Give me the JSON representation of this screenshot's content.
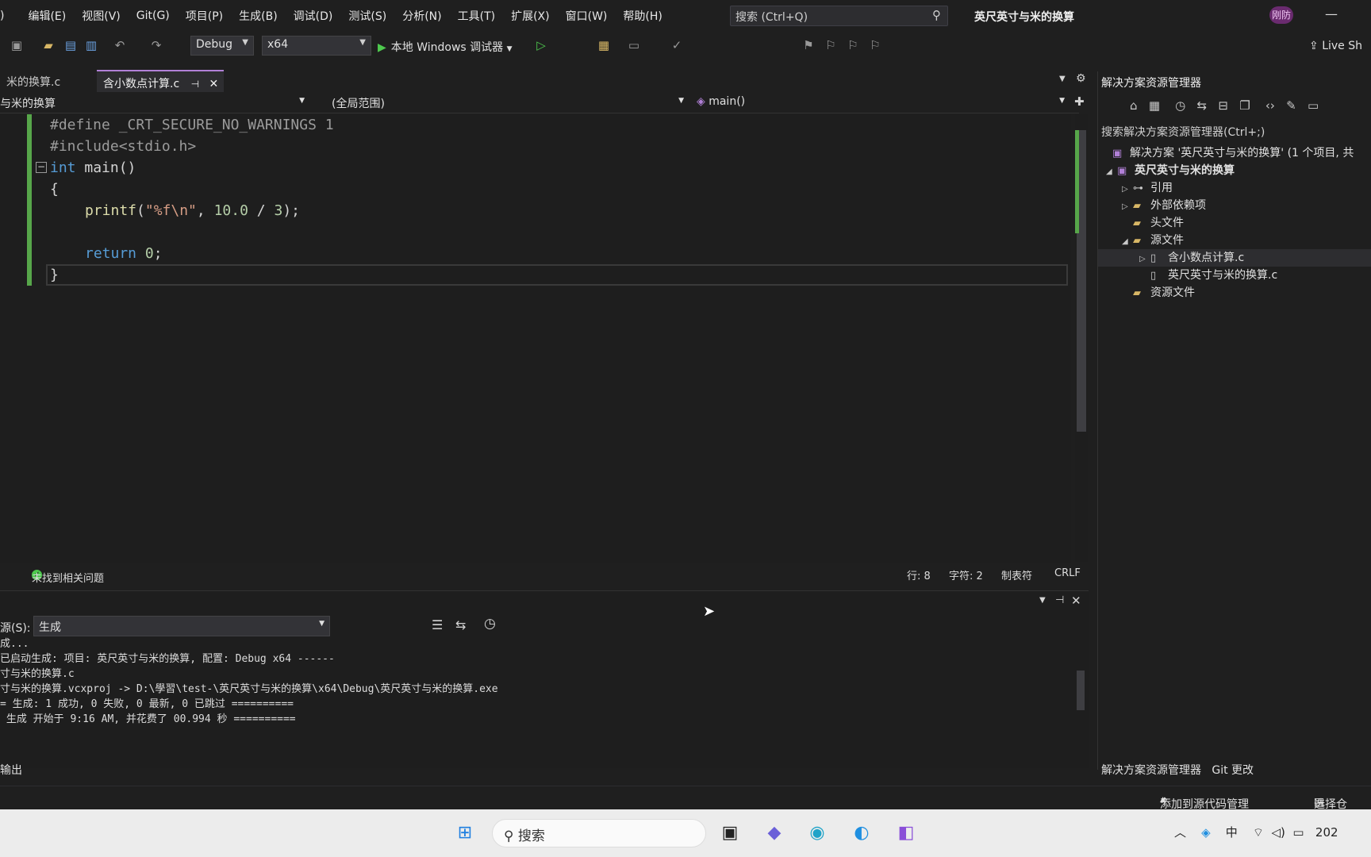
{
  "menubar": {
    "items": [
      ")",
      "编辑(E)",
      "视图(V)",
      "Git(G)",
      "项目(P)",
      "生成(B)",
      "调试(D)",
      "测试(S)",
      "分析(N)",
      "工具(T)",
      "扩展(X)",
      "窗口(W)",
      "帮助(H)"
    ],
    "search_placeholder": "搜索 (Ctrl+Q)",
    "window_title": "英尺英寸与米的换算",
    "avatar": "刚防"
  },
  "toolbar": {
    "config": "Debug",
    "platform": "x64",
    "run_label": "本地 Windows 调试器",
    "live_share": "Live Sh"
  },
  "tabs": [
    {
      "label": "米的换算.c",
      "active": false
    },
    {
      "label": "含小数点计算.c",
      "active": true
    }
  ],
  "navbar": {
    "project": "与米的换算",
    "scope": "(全局范围)",
    "member": "main()"
  },
  "code": {
    "l1_define": "#define",
    "l1_macro": " _CRT_SECURE_NO_WARNINGS 1",
    "l2": "#include<stdio.h>",
    "l3_kw": "int",
    "l3_rest": " main()",
    "l4": "{",
    "l5_fn": "printf",
    "l5_open": "(",
    "l5_str": "\"%f\\n\"",
    "l5_mid": ", ",
    "l5_num1": "10.0",
    "l5_op": " / ",
    "l5_num2": "3",
    "l5_close": ");",
    "l7_kw": "return",
    "l7_num": " 0",
    "l7_semi": ";",
    "l8": "}"
  },
  "editor_status": {
    "issues": "未找到相关问题",
    "line": "行: 8",
    "char": "字符: 2",
    "tabs": "制表符",
    "eol": "CRLF"
  },
  "output": {
    "source_label": "源(S):",
    "source_value": "生成",
    "lines": [
      "成...",
      "已启动生成: 项目: 英尺英寸与米的换算, 配置: Debug x64 ------",
      "寸与米的换算.c",
      "寸与米的换算.vcxproj -> D:\\學習\\test-\\英尺英寸与米的换算\\x64\\Debug\\英尺英寸与米的换算.exe",
      "= 生成: 1 成功, 0 失败, 0 最新, 0 已跳过 ==========",
      " 生成 开始于 9:16 AM, 并花费了 00.994 秒 =========="
    ],
    "tab_label": "输出"
  },
  "solution_explorer": {
    "title": "解决方案资源管理器",
    "search": "搜索解决方案资源管理器(Ctrl+;)",
    "solution": "解决方案 '英尺英寸与米的换算' (1 个项目, 共",
    "project": "英尺英寸与米的换算",
    "items": [
      "引用",
      "外部依赖项",
      "头文件",
      "源文件",
      "含小数点计算.c",
      "英尺英寸与米的换算.c",
      "资源文件"
    ],
    "bottom_tabs": [
      "解决方案资源管理器",
      "Git 更改"
    ]
  },
  "statusbar": {
    "source_control": "添加到源代码管理",
    "repo": "选择仓"
  },
  "taskbar": {
    "search": "搜索",
    "ime": "中",
    "clock": "202"
  }
}
